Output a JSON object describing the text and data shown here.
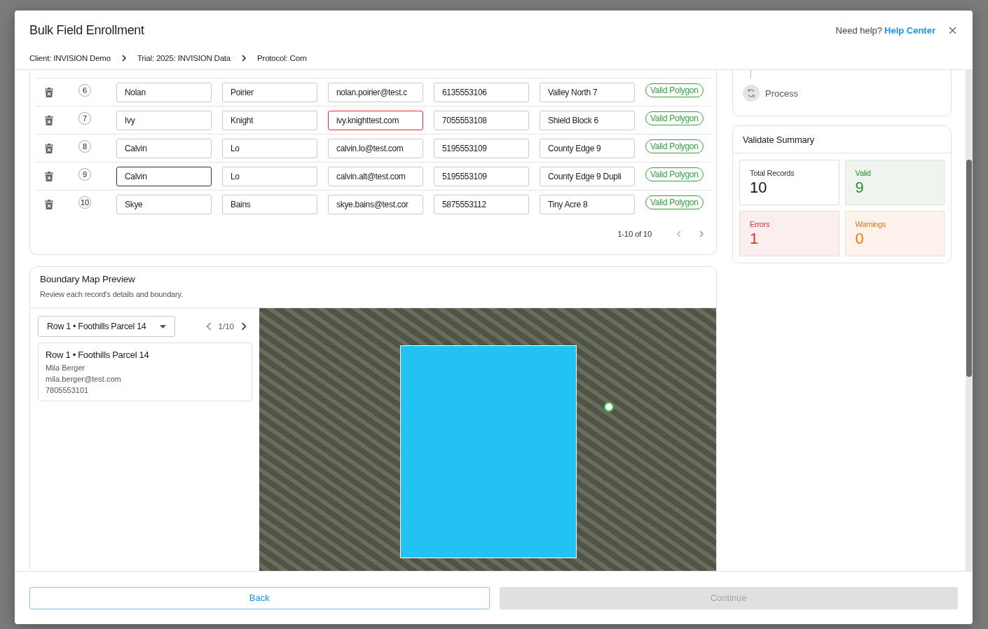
{
  "dialog": {
    "title": "Bulk Field Enrollment",
    "help_text": "Need help?",
    "help_link": "Help Center"
  },
  "breadcrumbs": [
    "Client: INVISION Demo",
    "Trial: 2025: INVISION Data",
    "Protocol: Corn"
  ],
  "records": {
    "rows": [
      {
        "number": "6",
        "cells": [
          {
            "value": "Nolan",
            "error": false,
            "focused": false
          },
          {
            "value": "Poirier",
            "error": false,
            "focused": false
          },
          {
            "value": "nolan.poirier@test.c",
            "error": false,
            "focused": false
          },
          {
            "value": "6135553106",
            "error": false,
            "focused": false
          },
          {
            "value": "Valley North 7",
            "error": false,
            "focused": false
          }
        ],
        "status": "Valid Polygon"
      },
      {
        "number": "7",
        "cells": [
          {
            "value": "Ivy",
            "error": false,
            "focused": false
          },
          {
            "value": "Knight",
            "error": false,
            "focused": false
          },
          {
            "value": "ivy.knighttest.com",
            "error": true,
            "focused": false
          },
          {
            "value": "7055553108",
            "error": false,
            "focused": false
          },
          {
            "value": "Shield Block 6",
            "error": false,
            "focused": false
          }
        ],
        "status": "Valid Polygon"
      },
      {
        "number": "8",
        "cells": [
          {
            "value": "Calvin",
            "error": false,
            "focused": false
          },
          {
            "value": "Lo",
            "error": false,
            "focused": false
          },
          {
            "value": "calvin.lo@test.com",
            "error": false,
            "focused": false
          },
          {
            "value": "5195553109",
            "error": false,
            "focused": false
          },
          {
            "value": "County Edge 9",
            "error": false,
            "focused": false
          }
        ],
        "status": "Valid Polygon"
      },
      {
        "number": "9",
        "cells": [
          {
            "value": "Calvin",
            "error": false,
            "focused": true
          },
          {
            "value": "Lo",
            "error": false,
            "focused": false
          },
          {
            "value": "calvin.alt@test.com",
            "error": false,
            "focused": false
          },
          {
            "value": "5195553109",
            "error": false,
            "focused": false
          },
          {
            "value": "County Edge 9 Dupli",
            "error": false,
            "focused": false
          }
        ],
        "status": "Valid Polygon"
      },
      {
        "number": "10",
        "cells": [
          {
            "value": "Skye",
            "error": false,
            "focused": false
          },
          {
            "value": "Bains",
            "error": false,
            "focused": false
          },
          {
            "value": "skye.bains@test.cor",
            "error": false,
            "focused": false
          },
          {
            "value": "5875553112",
            "error": false,
            "focused": false
          },
          {
            "value": "Tiny Acre 8",
            "error": false,
            "focused": false
          }
        ],
        "status": "Valid Polygon"
      }
    ],
    "pagination": "1-10 of 10"
  },
  "steps": [
    {
      "label": "Process"
    }
  ],
  "summary": {
    "title": "Validate Summary",
    "stats": [
      {
        "kind": "total",
        "label": "Total Records",
        "value": "10"
      },
      {
        "kind": "valid",
        "label": "Valid",
        "value": "9"
      },
      {
        "kind": "error",
        "label": "Errors",
        "value": "1"
      },
      {
        "kind": "warning",
        "label": "Warnings",
        "value": "0"
      }
    ]
  },
  "map_preview": {
    "title": "Boundary Map Preview",
    "subtitle": "Review each record's details and boundary.",
    "record_select": "Row 1 • Foothills Parcel 14",
    "pager": "1/10",
    "record": {
      "title": "Row 1 • Foothills Parcel 14",
      "name": "Mila Berger",
      "email": "mila.berger@test.com",
      "phone": "7805553101"
    }
  },
  "footer": {
    "back": "Back",
    "continue": "Continue",
    "continue_disabled": true
  }
}
